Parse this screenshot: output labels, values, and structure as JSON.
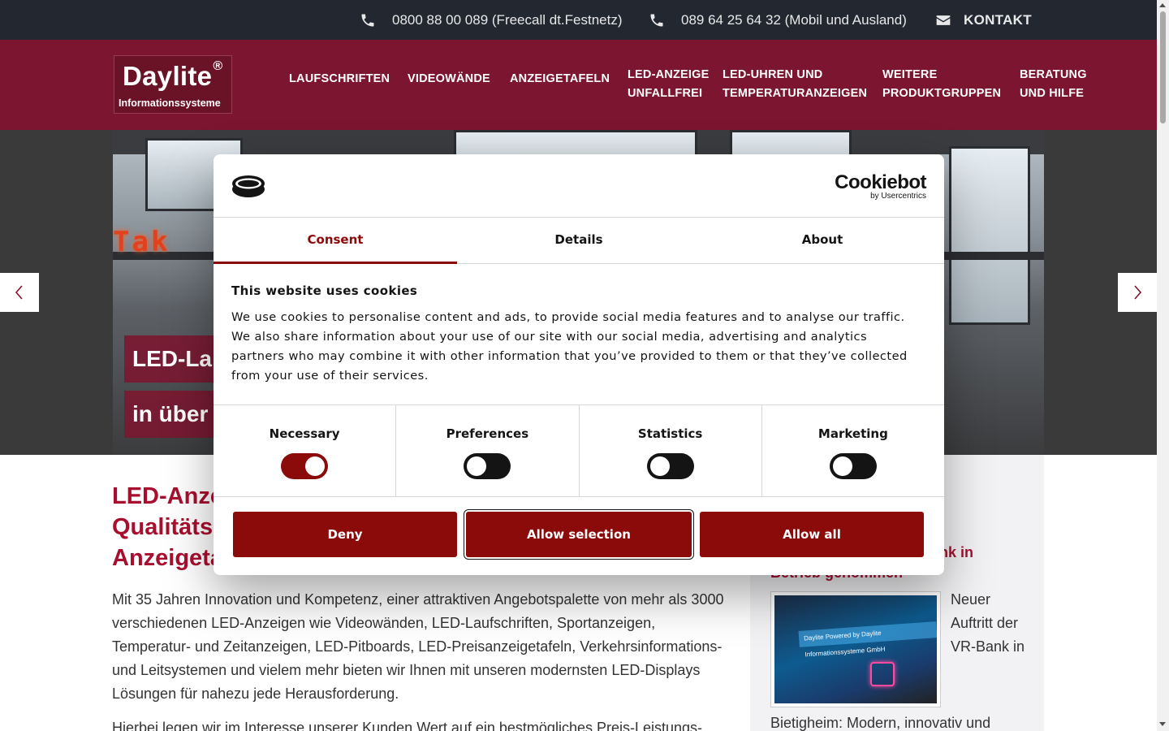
{
  "topbar": {
    "phone1": "0800 88 00 089 (Freecall dt.Festnetz)",
    "phone2": "089 64 25 64 32 (Mobil und Ausland)",
    "contact": "KONTAKT",
    "icons": [
      "phone-icon",
      "phone-icon",
      "envelope-icon"
    ]
  },
  "header": {
    "logo_name": "Daylite",
    "logo_mark": "®",
    "logo_sub": "Informationssysteme",
    "nav": [
      {
        "line1": "LAUFSCHRIFTEN",
        "line2": ""
      },
      {
        "line1": "VIDEOWÄNDE",
        "line2": ""
      },
      {
        "line1": "ANZEIGETAFELN",
        "line2": ""
      },
      {
        "line1": "LED-ANZEIGE",
        "line2": "UNFALLFREI"
      },
      {
        "line1": "LED-UHREN UND",
        "line2": "TEMPERATURANZEIGEN"
      },
      {
        "line1": "WEITERE",
        "line2": "PRODUKTGRUPPEN"
      },
      {
        "line1": "BERATUNG",
        "line2": "UND HILFE"
      }
    ]
  },
  "hero": {
    "led_text": "Tak",
    "caption1": "LED-La",
    "caption2": "in über"
  },
  "main": {
    "headline": "LED-Anze\nQualitäts\nAnzeigeta",
    "paragraph1": "Mit 35 Jahren Innovation und Kompetenz, einer attraktiven Angebotspalette von mehr als 3000 verschiedenen LED-Anzeigen wie Videowänden, LED-Laufschriften, Sportanzeigen, Temperatur- und Zeitanzeigen, LED-Pitboards, LED-Preisanzeigetafeln, Verkehrsinformations- und Leitsystemen und vielem mehr bieten wir Ihnen mit unseren modernsten LED-Displays Lösungen für nahezu jede Herausforderung.",
    "paragraph2": "Hierbei legen wir im Interesse unserer Kunden Wert auf ein bestmögliches Preis-Leistungs-"
  },
  "sidebar": {
    "title_line1": "ank in",
    "title_line2": "Betrieb genommen",
    "image_text": "Daylite Powered by Daylite Informationssysteme GmbH",
    "text_short": "Neuer Auftritt der VR-Bank in",
    "text_cont": "Bietigheim: Modern, innovativ und"
  },
  "cookie": {
    "brand": "Cookiebot",
    "brand_by": "by Usercentrics",
    "tabs": [
      "Consent",
      "Details",
      "About"
    ],
    "active_tab": "Consent",
    "title": "This website uses cookies",
    "text": "We use cookies to personalise content and ads, to provide social media features and to analyse our traffic. We also share information about your use of our site with our social media, advertising and analytics partners who may combine it with other information that you’ve provided to them or that they’ve collected from your use of their services.",
    "categories": [
      {
        "label": "Necessary",
        "on": true
      },
      {
        "label": "Preferences",
        "on": false
      },
      {
        "label": "Statistics",
        "on": false
      },
      {
        "label": "Marketing",
        "on": false
      }
    ],
    "buttons": [
      "Deny",
      "Allow selection",
      "Allow all"
    ],
    "accent": "#8b0a0a"
  },
  "colors": {
    "topbar": "#232730",
    "header": "#7c1630",
    "headline": "#a80f2e"
  }
}
